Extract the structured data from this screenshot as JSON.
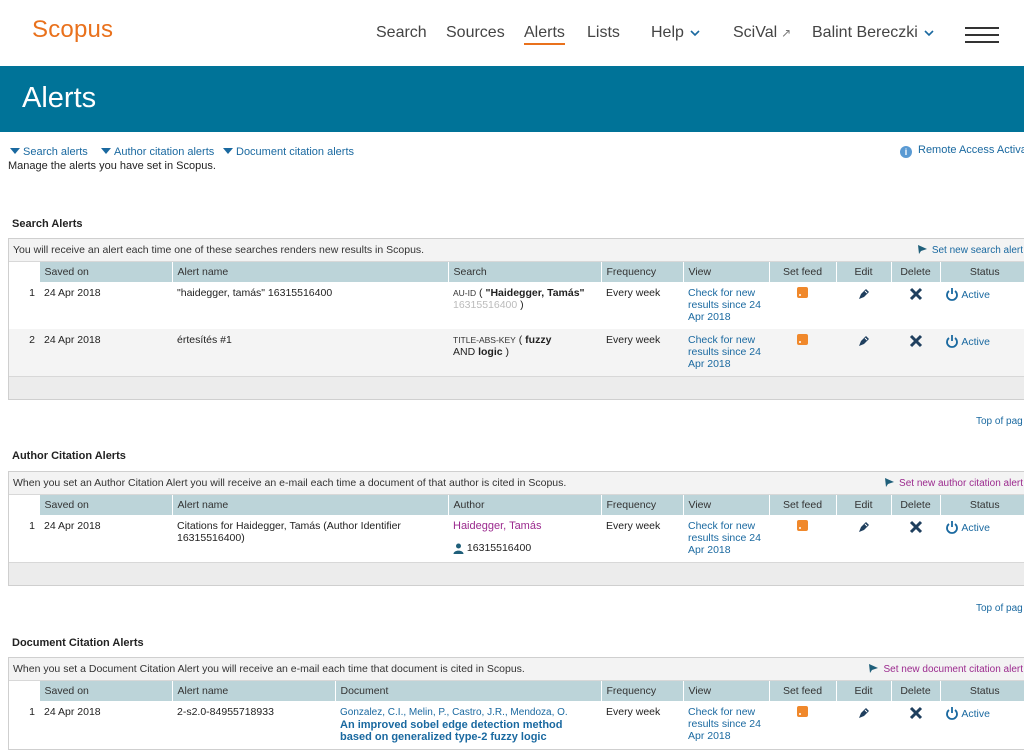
{
  "header": {
    "logo": "Scopus",
    "nav": [
      {
        "label": "Search"
      },
      {
        "label": "Sources"
      },
      {
        "label": "Alerts"
      },
      {
        "label": "Lists"
      },
      {
        "label": "Help"
      },
      {
        "label": "SciVal"
      },
      {
        "label": "Balint Bereczki"
      }
    ],
    "scival_mark": "↗",
    "page_title": "Alerts"
  },
  "jump_links": [
    {
      "label": "Search alerts"
    },
    {
      "label": "Author citation alerts"
    },
    {
      "label": "Document citation alerts"
    }
  ],
  "intro": "Manage the alerts you have set in Scopus.",
  "remote_access": "Remote Access Activatio",
  "top_of_page": "Top of pag",
  "search_alerts": {
    "title": "Search Alerts",
    "description": "You will receive an alert each time one of these searches renders new results in Scopus.",
    "set_new": "Set new search alert",
    "columns": [
      "Saved on",
      "Alert name",
      "Search",
      "Frequency",
      "View",
      "Set feed",
      "Edit",
      "Delete",
      "Status"
    ],
    "rows": [
      {
        "num": "1",
        "saved_on": "24 Apr 2018",
        "name": "\"haidegger, tamás\" 16315516400",
        "search_field": "AU-ID",
        "search_open": " ( ",
        "search_term": "\"Haidegger, Tamás\"",
        "search_extra": "16315516400",
        "search_close": " )",
        "frequency": "Every week",
        "view": "Check for new results since 24 Apr 2018",
        "status": "Active"
      },
      {
        "num": "2",
        "saved_on": "24 Apr 2018",
        "name": "értesítés #1",
        "search_field": "TITLE-ABS-KEY",
        "search_open": " ( ",
        "search_term": "fuzzy",
        "search_and": "AND ",
        "search_term2": "logic",
        "search_close": " )",
        "frequency": "Every week",
        "view": "Check for new results since 24 Apr 2018",
        "status": "Active"
      }
    ]
  },
  "author_alerts": {
    "title": "Author Citation Alerts",
    "description": "When you set an Author Citation Alert you will receive an e-mail each time a document of that author is cited in Scopus.",
    "set_new": "Set new author citation alert",
    "columns": [
      "Saved on",
      "Alert name",
      "Author",
      "Frequency",
      "View",
      "Set feed",
      "Edit",
      "Delete",
      "Status"
    ],
    "rows": [
      {
        "num": "1",
        "saved_on": "24 Apr 2018",
        "name": "Citations for Haidegger, Tamás (Author Identifier 16315516400)",
        "author": "Haidegger, Tamás",
        "author_id": "16315516400",
        "frequency": "Every week",
        "view": "Check for new results since 24 Apr 2018",
        "status": "Active"
      }
    ]
  },
  "document_alerts": {
    "title": "Document Citation Alerts",
    "description": "When you set a Document Citation Alert you will receive an e-mail each time that document is cited in Scopus.",
    "set_new": "Set new document citation alert",
    "columns": [
      "Saved on",
      "Alert name",
      "Document",
      "Frequency",
      "View",
      "Set feed",
      "Edit",
      "Delete",
      "Status"
    ],
    "rows": [
      {
        "num": "1",
        "saved_on": "24 Apr 2018",
        "name": "2-s2.0-84955718933",
        "doc_authors": "Gonzalez, C.I., Melin, P., Castro, J.R., Mendoza, O.",
        "doc_title": "An improved sobel edge detection method based on generalized type-2 fuzzy logic",
        "frequency": "Every week",
        "view": "Check for new results since 24 Apr 2018",
        "status": "Active"
      }
    ]
  },
  "colors": {
    "brand_orange": "#e9711c",
    "banner_teal": "#007398",
    "link_blue": "#1a69a0",
    "header_cell": "#bcd4d9",
    "delete_x": "#1f3f5e",
    "author_link": "#9b2a8e"
  }
}
